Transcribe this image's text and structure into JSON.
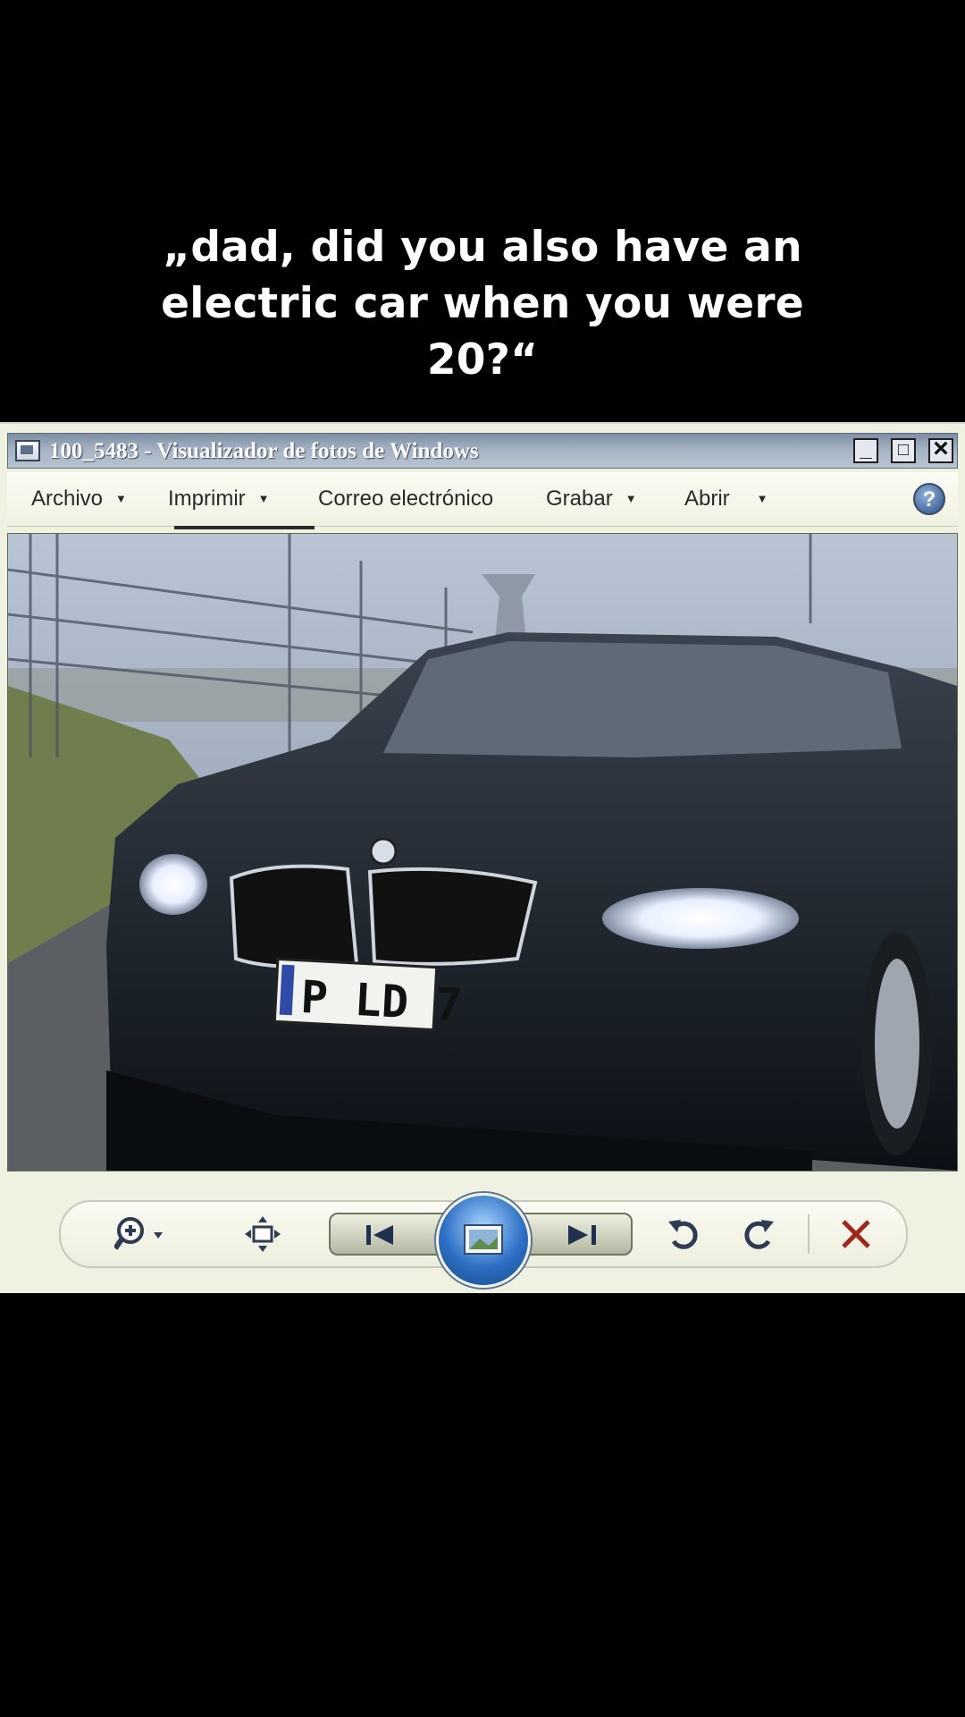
{
  "caption": {
    "line1": "„dad, did you also have an",
    "line2": "electric car when you were",
    "line3": "20?“"
  },
  "window": {
    "title": "100_5483 - Visualizador de fotos de Windows",
    "controls": {
      "minimize": "_",
      "maximize": "□",
      "close": "×"
    }
  },
  "menu": {
    "archivo": "Archivo",
    "imprimir": "Imprimir",
    "correo": "Correo electrónico",
    "grabar": "Grabar",
    "abrir": "Abrir",
    "caret": "▼",
    "help": "?"
  },
  "photo": {
    "plate": "P LD 7"
  },
  "toolbar": {
    "icons": [
      "zoom-icon",
      "fit-window-icon",
      "previous-icon",
      "slideshow-icon",
      "next-icon",
      "rotate-left-icon",
      "rotate-right-icon",
      "delete-icon"
    ]
  },
  "colors": {
    "background": "#000000",
    "window": "#eff1e1",
    "titlebar": "#a3b2c3",
    "delete": "#a5231b"
  }
}
